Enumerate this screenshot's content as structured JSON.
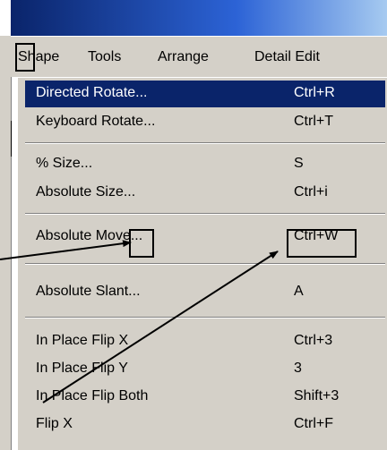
{
  "menubar": {
    "items": [
      {
        "label": "Shape"
      },
      {
        "label": "Tools"
      },
      {
        "label": "Arrange"
      },
      {
        "label": "Detail Edit"
      }
    ]
  },
  "shape_menu": {
    "items": [
      {
        "label": "Directed Rotate...",
        "shortcut": "Ctrl+R",
        "selected": true
      },
      {
        "label": "Keyboard Rotate...",
        "shortcut": "Ctrl+T"
      },
      {
        "label": "% Size...",
        "shortcut": "S"
      },
      {
        "label": "Absolute Size...",
        "shortcut": "Ctrl+i"
      },
      {
        "label": "Absolute Move...",
        "shortcut": "Ctrl+W"
      },
      {
        "label": "Absolute Slant...",
        "shortcut": "A"
      },
      {
        "label": "In Place Flip X",
        "shortcut": "Ctrl+3"
      },
      {
        "label": "In Place Flip Y",
        "shortcut": "3"
      },
      {
        "label": "In Place Flip Both",
        "shortcut": "Shift+3"
      },
      {
        "label": "Flip X",
        "shortcut": "Ctrl+F"
      }
    ]
  },
  "colors": {
    "menu_face": "#d4d0c8",
    "highlight": "#0a246a",
    "title_gradient_start": "#0a246a"
  }
}
